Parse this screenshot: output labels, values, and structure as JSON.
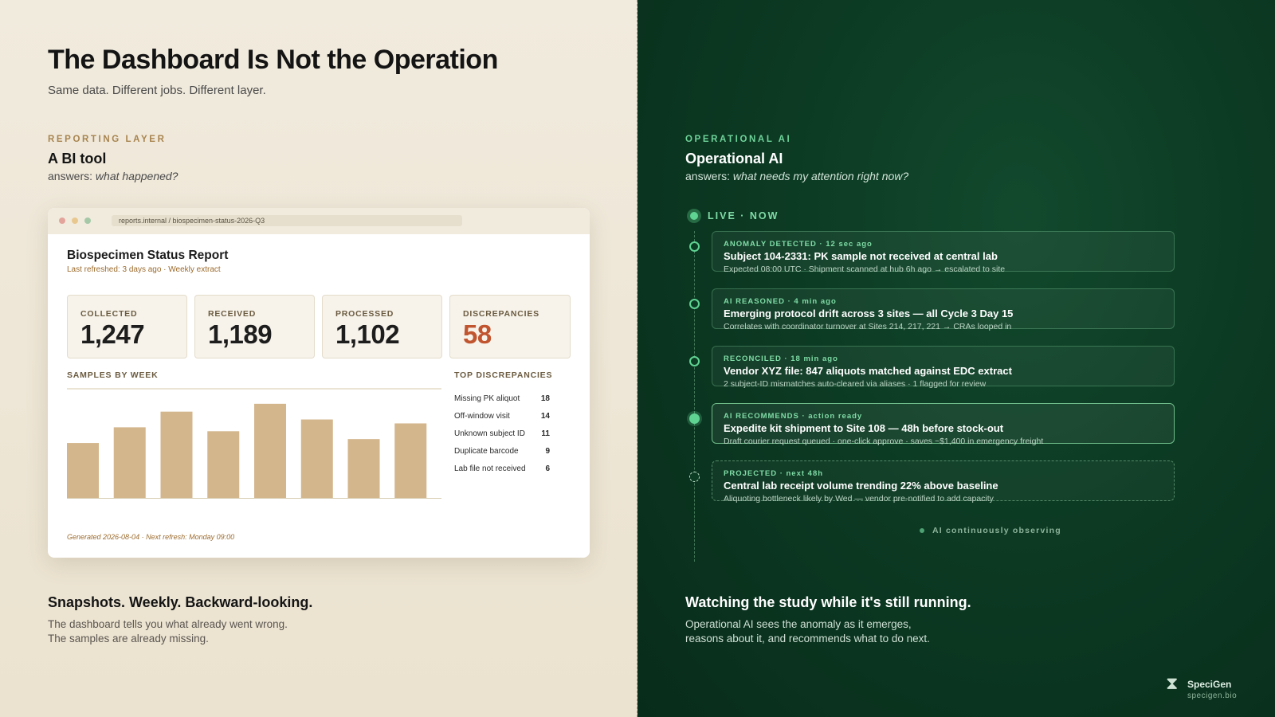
{
  "header": {
    "title": "The Dashboard Is Not the Operation",
    "subtitle": "Same data. Different jobs. Different layer."
  },
  "left": {
    "eyebrow": "REPORTING LAYER",
    "title": "A BI tool",
    "question_prefix": "answers: ",
    "question": "what happened?",
    "window": {
      "url": "reports.internal / biospecimen-status-2026-Q3",
      "report_title": "Biospecimen Status Report",
      "report_sub": "Last refreshed: 3 days ago · Weekly extract",
      "kpis": [
        {
          "label": "COLLECTED",
          "value": "1,247"
        },
        {
          "label": "RECEIVED",
          "value": "1,189"
        },
        {
          "label": "PROCESSED",
          "value": "1,102"
        },
        {
          "label": "DISCREPANCIES",
          "value": "58"
        }
      ],
      "chart_label": "SAMPLES BY WEEK",
      "discrepancies_label": "TOP DISCREPANCIES",
      "discrepancies": [
        {
          "label": "Missing PK aliquot",
          "value": "18"
        },
        {
          "label": "Off-window visit",
          "value": "14"
        },
        {
          "label": "Unknown subject ID",
          "value": "11"
        },
        {
          "label": "Duplicate barcode",
          "value": "9"
        },
        {
          "label": "Lab file not received",
          "value": "6"
        }
      ],
      "footer": "Generated 2026-08-04 · Next refresh: Monday 09:00"
    },
    "bottom_title": "Snapshots. Weekly. Backward-looking.",
    "bottom_line1": "The dashboard tells you what already went wrong.",
    "bottom_line2": "The samples are already missing."
  },
  "right": {
    "eyebrow": "OPERATIONAL AI",
    "title": "Operational AI",
    "question_prefix": "answers: ",
    "question": "what needs my attention right now?",
    "live_label": "LIVE · NOW",
    "events": [
      {
        "tag": "ANOMALY DETECTED · 12 sec ago",
        "title": "Subject 104-2331: PK sample not received at central lab",
        "sub": "Expected 08:00 UTC · Shipment scanned at hub 6h ago → escalated to site"
      },
      {
        "tag": "AI REASONED · 4 min ago",
        "title": "Emerging protocol drift across 3 sites — all Cycle 3 Day 15",
        "sub": "Correlates with coordinator turnover at Sites 214, 217, 221 → CRAs looped in"
      },
      {
        "tag": "RECONCILED · 18 min ago",
        "title": "Vendor XYZ file: 847 aliquots matched against EDC extract",
        "sub": "2 subject-ID mismatches auto-cleared via aliases · 1 flagged for review"
      },
      {
        "tag": "AI RECOMMENDS · action ready",
        "title": "Expedite kit shipment to Site 108 — 48h before stock-out",
        "sub": "Draft courier request queued · one-click approve · saves ~$1,400 in emergency freight"
      },
      {
        "tag": "PROJECTED · next 48h",
        "title": "Central lab receipt volume trending 22% above baseline",
        "sub": "Aliquoting bottleneck likely by Wed — vendor pre-notified to add capacity"
      }
    ],
    "observing": "AI continuously observing",
    "bottom_title": "Watching the study while it's still running.",
    "bottom_line1": "Operational AI sees the anomaly as it emerges,",
    "bottom_line2": "reasons about it, and recommends what to do next."
  },
  "brand": {
    "name": "SpeciGen",
    "url": "specigen.bio",
    "icon": "dna-icon"
  },
  "colors": {
    "left_bg": "#efe8da",
    "right_bg": "#0c3a23",
    "accent_brown": "#9c6b2d",
    "accent_green": "#7fdca6",
    "discrepancy_red": "#c0552f",
    "bar_fill": "#d4b68c"
  },
  "chart_data": {
    "type": "bar",
    "title": "SAMPLES BY WEEK",
    "categories": [
      "",
      "",
      "",
      "",
      "",
      "",
      "",
      ""
    ],
    "values": [
      70,
      90,
      110,
      85,
      120,
      100,
      75,
      95
    ],
    "ylim": [
      0,
      130
    ],
    "grid": false
  }
}
